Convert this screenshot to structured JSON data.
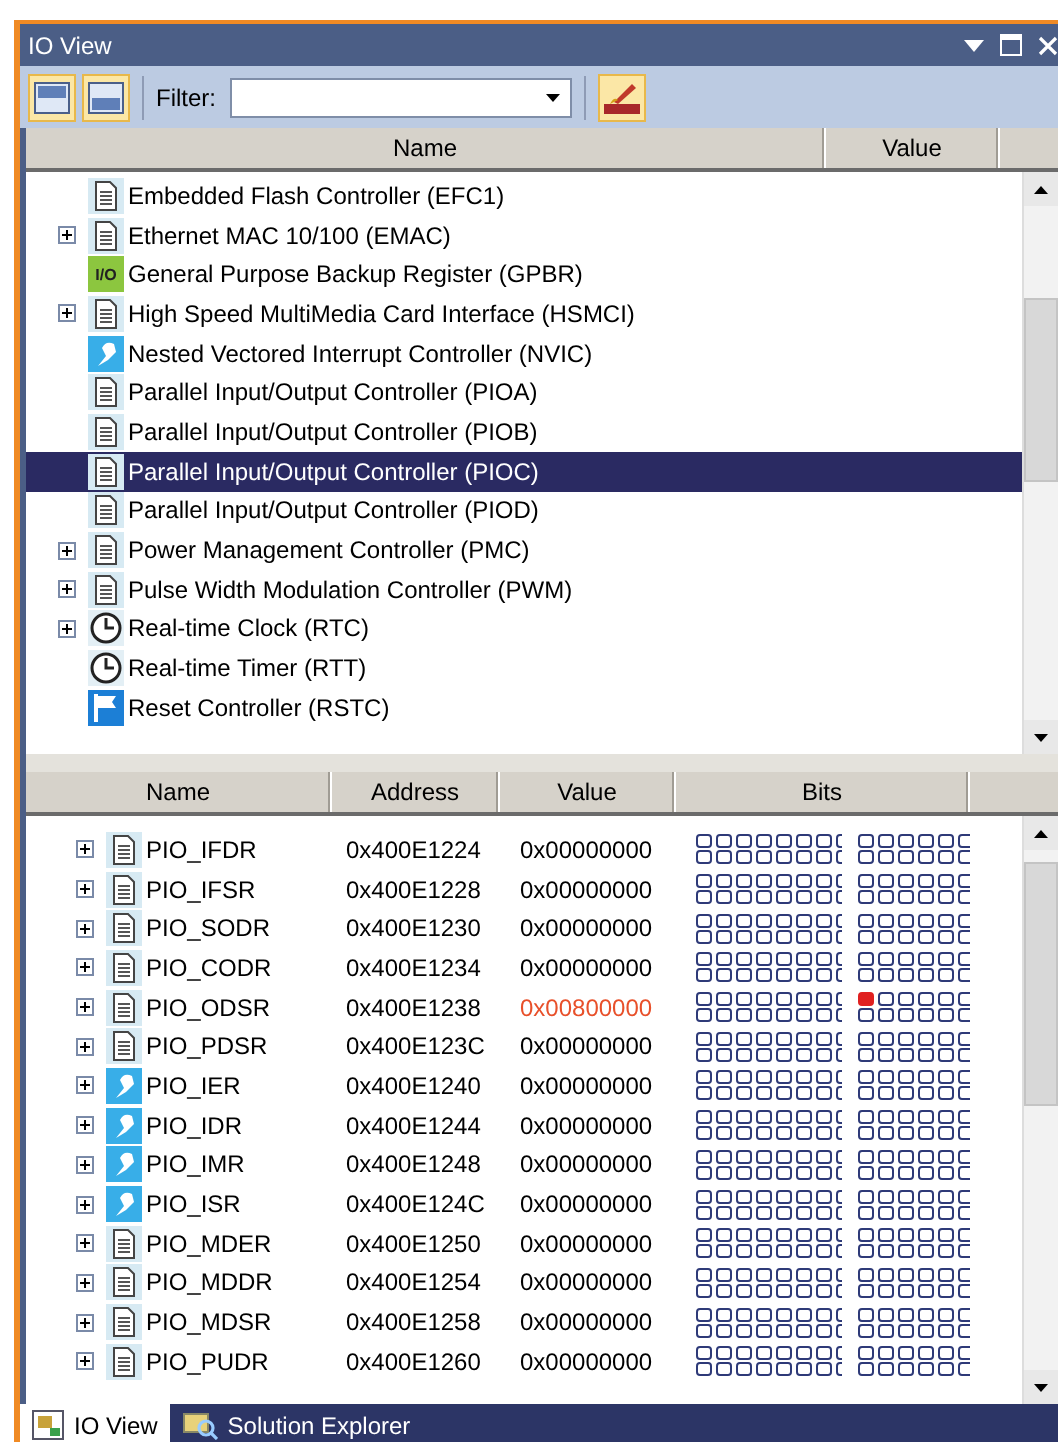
{
  "window": {
    "title": "IO View"
  },
  "toolbar": {
    "filter_label": "Filter:",
    "view_buttons": [
      {
        "selected": true
      },
      {
        "selected": true
      }
    ],
    "brush_button": {
      "selected": true
    }
  },
  "peripherals": {
    "columns": [
      "Name",
      "Value"
    ],
    "items": [
      {
        "name": "Embedded Flash Controller (EFC1)",
        "kind": "doc",
        "expandable": false,
        "selected": false
      },
      {
        "name": "Ethernet MAC 10/100 (EMAC)",
        "kind": "doc",
        "expandable": true,
        "selected": false
      },
      {
        "name": "General Purpose Backup Register (GPBR)",
        "kind": "io",
        "icon_label": "I/O",
        "expandable": false,
        "selected": false
      },
      {
        "name": "High Speed MultiMedia Card Interface (HSMCI)",
        "kind": "doc",
        "expandable": true,
        "selected": false
      },
      {
        "name": "Nested Vectored Interrupt Controller (NVIC)",
        "kind": "bell",
        "expandable": false,
        "selected": false
      },
      {
        "name": "Parallel Input/Output Controller (PIOA)",
        "kind": "doc",
        "expandable": false,
        "selected": false
      },
      {
        "name": "Parallel Input/Output Controller (PIOB)",
        "kind": "doc",
        "expandable": false,
        "selected": false
      },
      {
        "name": "Parallel Input/Output Controller (PIOC)",
        "kind": "doc",
        "expandable": false,
        "selected": true
      },
      {
        "name": "Parallel Input/Output Controller (PIOD)",
        "kind": "doc",
        "expandable": false,
        "selected": false
      },
      {
        "name": "Power Management Controller (PMC)",
        "kind": "doc",
        "expandable": true,
        "selected": false
      },
      {
        "name": "Pulse Width Modulation Controller (PWM)",
        "kind": "doc",
        "expandable": true,
        "selected": false
      },
      {
        "name": "Real-time Clock (RTC)",
        "kind": "clock",
        "expandable": true,
        "selected": false
      },
      {
        "name": "Real-time Timer (RTT)",
        "kind": "clock",
        "expandable": false,
        "selected": false
      },
      {
        "name": "Reset Controller (RSTC)",
        "kind": "flag",
        "expandable": false,
        "selected": false
      }
    ]
  },
  "registers": {
    "columns": [
      "Name",
      "Address",
      "Value",
      "Bits"
    ],
    "rows": [
      {
        "name": "PIO_IFDR",
        "kind": "doc",
        "address": "0x400E1224",
        "value": "0x00000000",
        "changed": false
      },
      {
        "name": "PIO_IFSR",
        "kind": "doc",
        "address": "0x400E1228",
        "value": "0x00000000",
        "changed": false
      },
      {
        "name": "PIO_SODR",
        "kind": "doc",
        "address": "0x400E1230",
        "value": "0x00000000",
        "changed": false
      },
      {
        "name": "PIO_CODR",
        "kind": "doc",
        "address": "0x400E1234",
        "value": "0x00000000",
        "changed": false
      },
      {
        "name": "PIO_ODSR",
        "kind": "doc",
        "address": "0x400E1238",
        "value": "0x00800000",
        "changed": true
      },
      {
        "name": "PIO_PDSR",
        "kind": "doc",
        "address": "0x400E123C",
        "value": "0x00000000",
        "changed": false
      },
      {
        "name": "PIO_IER",
        "kind": "bell",
        "address": "0x400E1240",
        "value": "0x00000000",
        "changed": false
      },
      {
        "name": "PIO_IDR",
        "kind": "bell",
        "address": "0x400E1244",
        "value": "0x00000000",
        "changed": false
      },
      {
        "name": "PIO_IMR",
        "kind": "bell",
        "address": "0x400E1248",
        "value": "0x00000000",
        "changed": false
      },
      {
        "name": "PIO_ISR",
        "kind": "bell",
        "address": "0x400E124C",
        "value": "0x00000000",
        "changed": false
      },
      {
        "name": "PIO_MDER",
        "kind": "doc",
        "address": "0x400E1250",
        "value": "0x00000000",
        "changed": false
      },
      {
        "name": "PIO_MDDR",
        "kind": "doc",
        "address": "0x400E1254",
        "value": "0x00000000",
        "changed": false
      },
      {
        "name": "PIO_MDSR",
        "kind": "doc",
        "address": "0x400E1258",
        "value": "0x00000000",
        "changed": false
      },
      {
        "name": "PIO_PUDR",
        "kind": "doc",
        "address": "0x400E1260",
        "value": "0x00000000",
        "changed": false
      }
    ]
  },
  "tabs": [
    {
      "label": "IO View",
      "kind": "io-view",
      "selected": true
    },
    {
      "label": "Solution Explorer",
      "kind": "solution",
      "selected": false
    }
  ]
}
